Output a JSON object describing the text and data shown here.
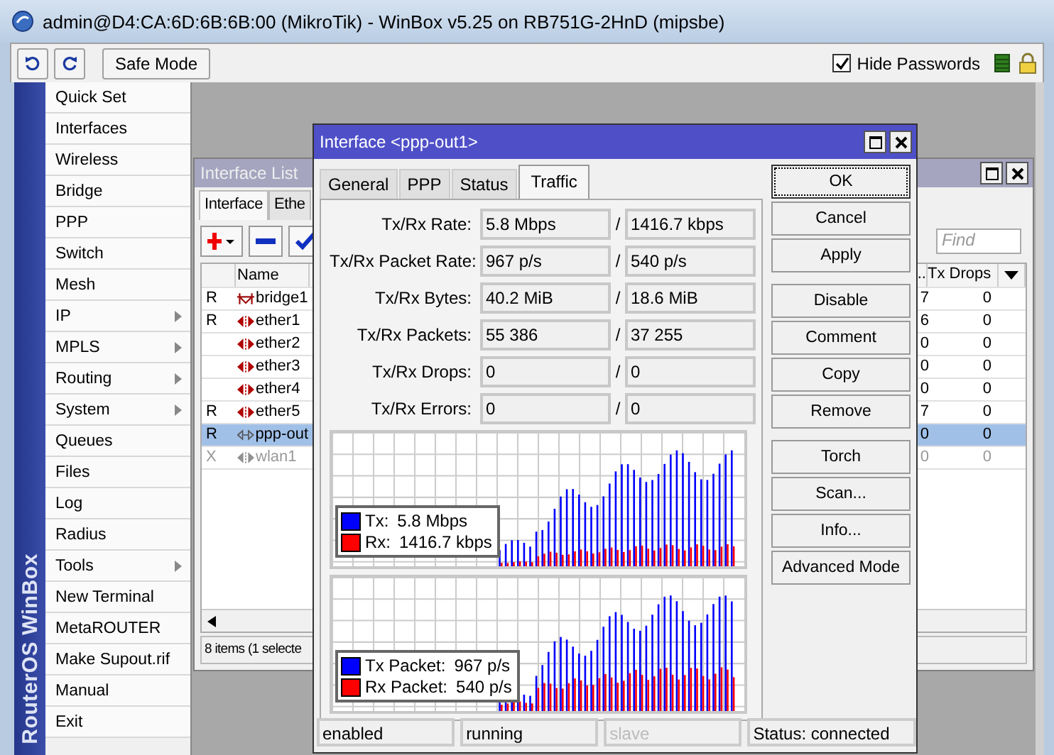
{
  "window": {
    "title": "admin@D4:CA:6D:6B:6B:00 (MikroTik) - WinBox v5.25 on RB751G-2HnD (mipsbe)"
  },
  "toolbar": {
    "safe_mode": "Safe Mode",
    "hide_passwords": {
      "label": "Hide Passwords",
      "checked": true
    }
  },
  "sidebar": {
    "brand": "RouterOS WinBox",
    "items": [
      {
        "label": "Quick Set",
        "submenu": false
      },
      {
        "label": "Interfaces",
        "submenu": false
      },
      {
        "label": "Wireless",
        "submenu": false
      },
      {
        "label": "Bridge",
        "submenu": false
      },
      {
        "label": "PPP",
        "submenu": false
      },
      {
        "label": "Switch",
        "submenu": false
      },
      {
        "label": "Mesh",
        "submenu": false
      },
      {
        "label": "IP",
        "submenu": true
      },
      {
        "label": "MPLS",
        "submenu": true
      },
      {
        "label": "Routing",
        "submenu": true
      },
      {
        "label": "System",
        "submenu": true
      },
      {
        "label": "Queues",
        "submenu": false
      },
      {
        "label": "Files",
        "submenu": false
      },
      {
        "label": "Log",
        "submenu": false
      },
      {
        "label": "Radius",
        "submenu": false
      },
      {
        "label": "Tools",
        "submenu": true
      },
      {
        "label": "New Terminal",
        "submenu": false
      },
      {
        "label": "MetaROUTER",
        "submenu": false
      },
      {
        "label": "Make Supout.rif",
        "submenu": false
      },
      {
        "label": "Manual",
        "submenu": false
      },
      {
        "label": "Exit",
        "submenu": false
      }
    ]
  },
  "interface_list": {
    "title": "Interface List",
    "tabs": [
      {
        "label": "Interface",
        "selected": true
      },
      {
        "label": "Ethe",
        "selected": false
      }
    ],
    "find_placeholder": "Find",
    "columns": {
      "name": "Name",
      "column_3": "..",
      "tx_drops": "Tx Drops"
    },
    "rows": [
      {
        "flag": "R",
        "kind": "bridge",
        "name": "bridge1",
        "column_3": "7",
        "tx_drops": "0",
        "selected": false,
        "disabled": false
      },
      {
        "flag": "R",
        "kind": "ether",
        "name": "ether1",
        "column_3": "6",
        "tx_drops": "0",
        "selected": false,
        "disabled": false
      },
      {
        "flag": "",
        "kind": "ether",
        "name": "ether2",
        "column_3": "0",
        "tx_drops": "0",
        "selected": false,
        "disabled": false
      },
      {
        "flag": "",
        "kind": "ether",
        "name": "ether3",
        "column_3": "0",
        "tx_drops": "0",
        "selected": false,
        "disabled": false
      },
      {
        "flag": "",
        "kind": "ether",
        "name": "ether4",
        "column_3": "0",
        "tx_drops": "0",
        "selected": false,
        "disabled": false
      },
      {
        "flag": "R",
        "kind": "ether",
        "name": "ether5",
        "column_3": "7",
        "tx_drops": "0",
        "selected": false,
        "disabled": false
      },
      {
        "flag": "R",
        "kind": "ppp",
        "name": "ppp-out",
        "column_3": "0",
        "tx_drops": "0",
        "selected": true,
        "disabled": false
      },
      {
        "flag": "X",
        "kind": "wlan",
        "name": "wlan1",
        "column_3": "0",
        "tx_drops": "0",
        "selected": false,
        "disabled": true
      }
    ],
    "status": "8 items (1 selecte"
  },
  "dialog": {
    "title": "Interface <ppp-out1>",
    "tabs": [
      {
        "label": "General",
        "selected": false
      },
      {
        "label": "PPP",
        "selected": false
      },
      {
        "label": "Status",
        "selected": false
      },
      {
        "label": "Traffic",
        "selected": true
      }
    ],
    "fields": [
      {
        "label": "Tx/Rx Rate:",
        "tx": "5.8 Mbps",
        "separator": "/",
        "rx": "1416.7 kbps"
      },
      {
        "label": "Tx/Rx Packet Rate:",
        "tx": "967 p/s",
        "separator": "/",
        "rx": "540 p/s"
      },
      {
        "label": "Tx/Rx Bytes:",
        "tx": "40.2 MiB",
        "separator": "/",
        "rx": "18.6 MiB"
      },
      {
        "label": "Tx/Rx Packets:",
        "tx": "55 386",
        "separator": "/",
        "rx": "37 255"
      },
      {
        "label": "Tx/Rx Drops:",
        "tx": "0",
        "separator": "/",
        "rx": "0"
      },
      {
        "label": "Tx/Rx Errors:",
        "tx": "0",
        "separator": "/",
        "rx": "0"
      }
    ],
    "graphs": [
      {
        "legend": [
          {
            "label": "Tx:",
            "value": "5.8 Mbps",
            "color": "#0000ff"
          },
          {
            "label": "Rx:",
            "value": "1416.7 kbps",
            "color": "#ff0000"
          }
        ]
      },
      {
        "legend": [
          {
            "label": "Tx Packet:",
            "value": "967 p/s",
            "color": "#0000ff"
          },
          {
            "label": "Rx Packet:",
            "value": "540 p/s",
            "color": "#ff0000"
          }
        ]
      }
    ],
    "button_groups": [
      [
        {
          "label": "OK",
          "focused": true
        },
        {
          "label": "Cancel",
          "focused": false
        },
        {
          "label": "Apply",
          "focused": false
        }
      ],
      [
        {
          "label": "Disable",
          "focused": false
        },
        {
          "label": "Comment",
          "focused": false
        },
        {
          "label": "Copy",
          "focused": false
        },
        {
          "label": "Remove",
          "focused": false
        }
      ],
      [
        {
          "label": "Torch",
          "focused": false
        },
        {
          "label": "Scan...",
          "focused": false
        },
        {
          "label": "Info...",
          "focused": false
        },
        {
          "label": "Advanced Mode",
          "focused": false
        }
      ]
    ],
    "status_bar": [
      {
        "text": "enabled",
        "disabled": false
      },
      {
        "text": "running",
        "disabled": false
      },
      {
        "text": "slave",
        "disabled": true
      },
      {
        "text": "Status: connected",
        "disabled": false
      }
    ]
  }
}
